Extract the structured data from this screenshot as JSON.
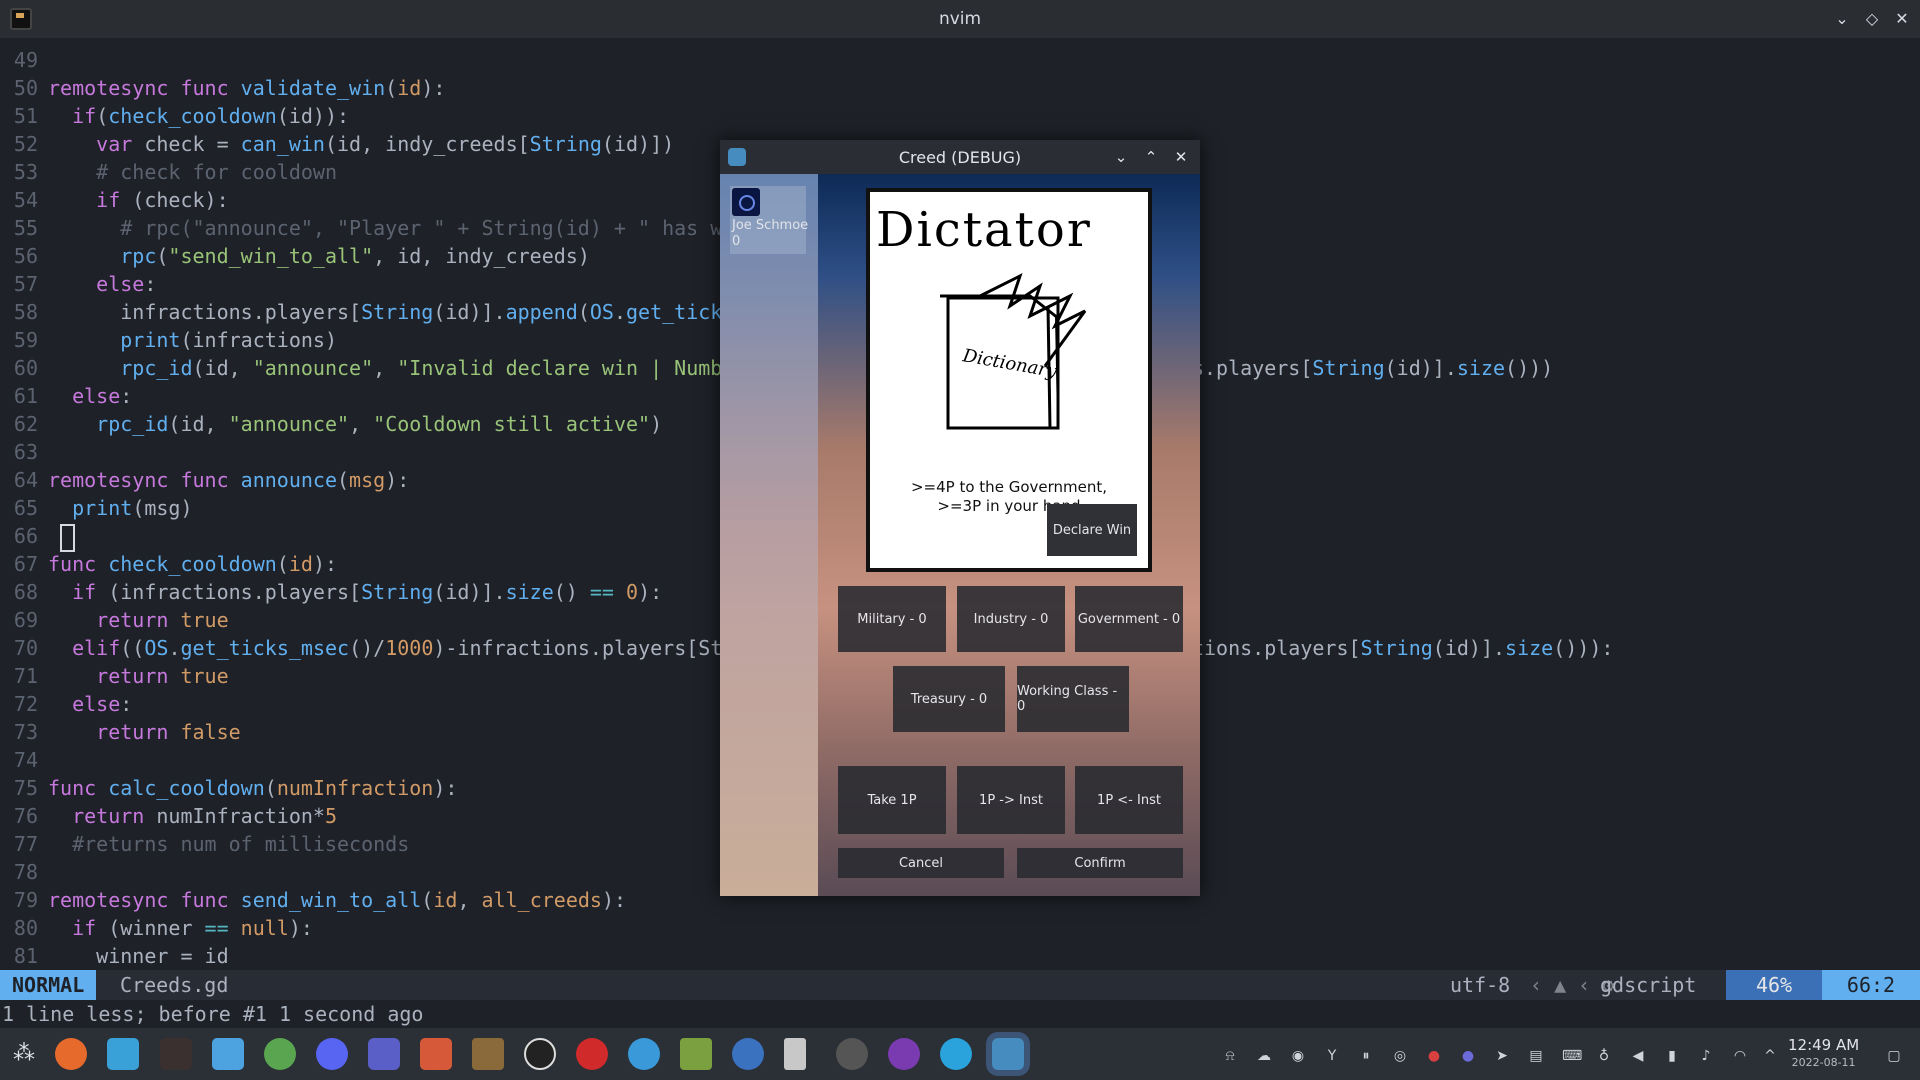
{
  "window": {
    "title": "nvim"
  },
  "editor": {
    "lines": [
      {
        "n": "49",
        "segs": []
      },
      {
        "n": "50",
        "segs": [
          [
            "kw",
            "remotesync "
          ],
          [
            "kw",
            "func "
          ],
          [
            "fn",
            "validate_win"
          ],
          [
            "",
            "("
          ],
          [
            "nm",
            "id"
          ],
          [
            "",
            "):"
          ]
        ]
      },
      {
        "n": "51",
        "segs": [
          [
            "",
            "  "
          ],
          [
            "kw",
            "if"
          ],
          [
            "",
            "("
          ],
          [
            "fn",
            "check_cooldown"
          ],
          [
            "",
            "(id)):"
          ]
        ]
      },
      {
        "n": "52",
        "segs": [
          [
            "",
            "    "
          ],
          [
            "kw",
            "var "
          ],
          [
            "",
            "check = "
          ],
          [
            "fn",
            "can_win"
          ],
          [
            "",
            "(id, indy_creeds["
          ],
          [
            "ty",
            "String"
          ],
          [
            "",
            "(id)])"
          ]
        ]
      },
      {
        "n": "53",
        "segs": [
          [
            "",
            "    "
          ],
          [
            "cm",
            "# check for cooldown"
          ]
        ]
      },
      {
        "n": "54",
        "segs": [
          [
            "",
            "    "
          ],
          [
            "kw",
            "if "
          ],
          [
            "",
            "(check):"
          ]
        ]
      },
      {
        "n": "55",
        "segs": [
          [
            "",
            "      "
          ],
          [
            "cm",
            "# rpc(\"announce\", \"Player \" + String(id) + \" has w"
          ]
        ]
      },
      {
        "n": "56",
        "segs": [
          [
            "",
            "      "
          ],
          [
            "fn",
            "rpc"
          ],
          [
            "",
            "("
          ],
          [
            "st",
            "\"send_win_to_all\""
          ],
          [
            "",
            ", id, indy_creeds)"
          ]
        ]
      },
      {
        "n": "57",
        "segs": [
          [
            "",
            "    "
          ],
          [
            "kw",
            "else"
          ],
          [
            "",
            ":"
          ]
        ]
      },
      {
        "n": "58",
        "segs": [
          [
            "",
            "      infractions.players["
          ],
          [
            "ty",
            "String"
          ],
          [
            "",
            "(id)]."
          ],
          [
            "fn",
            "append"
          ],
          [
            "",
            "("
          ],
          [
            "ty",
            "OS"
          ],
          [
            "",
            "."
          ],
          [
            "fn",
            "get_tick"
          ]
        ]
      },
      {
        "n": "59",
        "segs": [
          [
            "",
            "      "
          ],
          [
            "fn",
            "print"
          ],
          [
            "",
            "(infractions)"
          ]
        ]
      },
      {
        "n": "60",
        "segs": [
          [
            "",
            "      "
          ],
          [
            "fn",
            "rpc_id"
          ],
          [
            "",
            "(id, "
          ],
          [
            "st",
            "\"announce\""
          ],
          [
            "",
            ", "
          ],
          [
            "st",
            "\"Invalid declare win | Numb"
          ],
          [
            "",
            "                                       s.players["
          ],
          [
            "ty",
            "String"
          ],
          [
            "",
            "(id)]."
          ],
          [
            "fn",
            "size"
          ],
          [
            "",
            "()))"
          ]
        ]
      },
      {
        "n": "61",
        "segs": [
          [
            "",
            "  "
          ],
          [
            "kw",
            "else"
          ],
          [
            "",
            ":"
          ]
        ]
      },
      {
        "n": "62",
        "segs": [
          [
            "",
            "    "
          ],
          [
            "fn",
            "rpc_id"
          ],
          [
            "",
            "(id, "
          ],
          [
            "st",
            "\"announce\""
          ],
          [
            "",
            ", "
          ],
          [
            "st",
            "\"Cooldown still active\""
          ],
          [
            "",
            ")"
          ]
        ]
      },
      {
        "n": "63",
        "segs": []
      },
      {
        "n": "64",
        "segs": [
          [
            "kw",
            "remotesync "
          ],
          [
            "kw",
            "func "
          ],
          [
            "fn",
            "announce"
          ],
          [
            "",
            "("
          ],
          [
            "nm",
            "msg"
          ],
          [
            "",
            "):"
          ]
        ]
      },
      {
        "n": "65",
        "segs": [
          [
            "",
            "  "
          ],
          [
            "fn",
            "print"
          ],
          [
            "",
            "(msg)"
          ]
        ]
      },
      {
        "n": "66",
        "segs": [
          [
            "cursor",
            ""
          ]
        ]
      },
      {
        "n": "67",
        "segs": [
          [
            "kw",
            "func "
          ],
          [
            "fn",
            "check_cooldown"
          ],
          [
            "",
            "("
          ],
          [
            "nm",
            "id"
          ],
          [
            "",
            "):"
          ]
        ]
      },
      {
        "n": "68",
        "segs": [
          [
            "",
            "  "
          ],
          [
            "kw",
            "if "
          ],
          [
            "",
            "(infractions.players["
          ],
          [
            "ty",
            "String"
          ],
          [
            "",
            "(id)]."
          ],
          [
            "fn",
            "size"
          ],
          [
            "",
            "() "
          ],
          [
            "op",
            "=="
          ],
          [
            "",
            ""
          ],
          [
            "nm",
            " 0"
          ],
          [
            "",
            "):"
          ]
        ]
      },
      {
        "n": "69",
        "segs": [
          [
            "",
            "    "
          ],
          [
            "kw",
            "return "
          ],
          [
            "nm",
            "true"
          ]
        ]
      },
      {
        "n": "70",
        "segs": [
          [
            "",
            "  "
          ],
          [
            "kw",
            "elif"
          ],
          [
            "",
            "(("
          ],
          [
            "ty",
            "OS"
          ],
          [
            "",
            "."
          ],
          [
            "fn",
            "get_ticks_msec"
          ],
          [
            "",
            "()/"
          ],
          [
            "nm",
            "1000"
          ],
          [
            "",
            ")-infractions.players[St"
          ],
          [
            "",
            "                                       tions.players["
          ],
          [
            "ty",
            "String"
          ],
          [
            "",
            "(id)]."
          ],
          [
            "fn",
            "size"
          ],
          [
            "",
            "())):"
          ]
        ]
      },
      {
        "n": "71",
        "segs": [
          [
            "",
            "    "
          ],
          [
            "kw",
            "return "
          ],
          [
            "nm",
            "true"
          ]
        ]
      },
      {
        "n": "72",
        "segs": [
          [
            "",
            "  "
          ],
          [
            "kw",
            "else"
          ],
          [
            "",
            ":"
          ]
        ]
      },
      {
        "n": "73",
        "segs": [
          [
            "",
            "    "
          ],
          [
            "kw",
            "return "
          ],
          [
            "nm",
            "false"
          ]
        ]
      },
      {
        "n": "74",
        "segs": []
      },
      {
        "n": "75",
        "segs": [
          [
            "kw",
            "func "
          ],
          [
            "fn",
            "calc_cooldown"
          ],
          [
            "",
            "("
          ],
          [
            "nm",
            "numInfraction"
          ],
          [
            "",
            "):"
          ]
        ]
      },
      {
        "n": "76",
        "segs": [
          [
            "",
            "  "
          ],
          [
            "kw",
            "return "
          ],
          [
            "",
            "numInfraction*"
          ],
          [
            "nm",
            "5"
          ]
        ]
      },
      {
        "n": "77",
        "segs": [
          [
            "",
            "  "
          ],
          [
            "cm",
            "#returns num of milliseconds"
          ]
        ]
      },
      {
        "n": "78",
        "segs": []
      },
      {
        "n": "79",
        "segs": [
          [
            "kw",
            "remotesync "
          ],
          [
            "kw",
            "func "
          ],
          [
            "fn",
            "send_win_to_all"
          ],
          [
            "",
            "("
          ],
          [
            "nm",
            "id"
          ],
          [
            "",
            ", "
          ],
          [
            "nm",
            "all_creeds"
          ],
          [
            "",
            "):"
          ]
        ]
      },
      {
        "n": "80",
        "segs": [
          [
            "",
            "  "
          ],
          [
            "kw",
            "if "
          ],
          [
            "",
            "(winner "
          ],
          [
            "op",
            "=="
          ],
          [
            "",
            ""
          ],
          [
            "nm",
            " null"
          ],
          [
            "",
            "):"
          ]
        ]
      },
      {
        "n": "81",
        "segs": [
          [
            "",
            "    winner = id"
          ]
        ]
      }
    ]
  },
  "statusline": {
    "mode": "NORMAL",
    "filename": "Creeds.gd",
    "encoding": "utf-8",
    "filetype": "gdscript",
    "percent": "46%",
    "position": "66:2"
  },
  "message": "1 line less; before #1  1 second ago",
  "godot": {
    "title": "Creed (DEBUG)",
    "player": {
      "name": "Joe Schmoe",
      "score": "0"
    },
    "card": {
      "title": "Dictator",
      "illustration_text": "Dictionary",
      "text_line1": ">=4P to the Government,",
      "text_line2": ">=3P in your hand"
    },
    "declare_win": "Declare Win",
    "institutions": [
      "Military - 0",
      "Industry - 0",
      "Government - 0",
      "Treasury - 0",
      "Working Class - 0"
    ],
    "actions": [
      "Take 1P",
      "1P -> Inst",
      "1P <- Inst"
    ],
    "cancel": "Cancel",
    "confirm": "Confirm"
  },
  "clock": {
    "time": "12:49 AM",
    "date": "2022-08-11"
  }
}
